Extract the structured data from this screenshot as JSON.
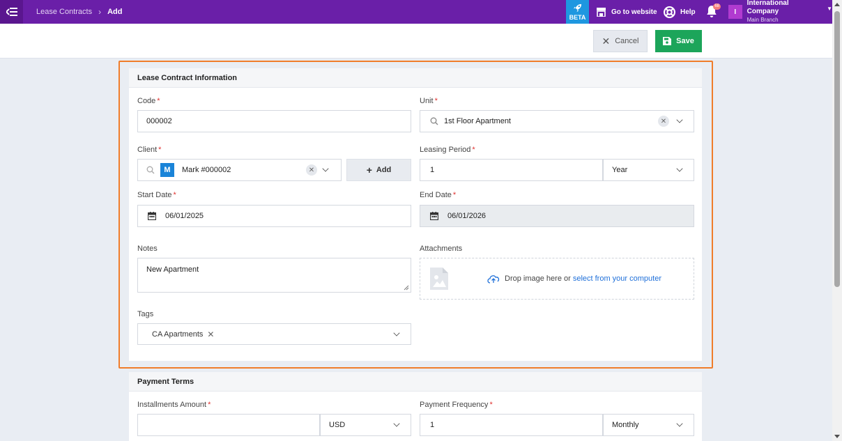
{
  "topbar": {
    "breadcrumb": [
      "Lease Contracts",
      "Add"
    ],
    "beta_label": "BETA",
    "go_to_website": "Go to website",
    "help": "Help",
    "notification_count": "68",
    "company_initial": "I",
    "company_name": "International Company",
    "branch_name": "Main Branch",
    "color_brand": "#6a1fa8",
    "color_beta": "#1e97e0"
  },
  "actions": {
    "cancel_label": "Cancel",
    "save_label": "Save",
    "color_save": "#1ca55a"
  },
  "lease_info": {
    "title": "Lease Contract Information",
    "code": {
      "label": "Code",
      "value": "000002"
    },
    "unit": {
      "label": "Unit",
      "value": "1st Floor Apartment"
    },
    "client": {
      "label": "Client",
      "initial": "M",
      "value": "Mark #000002",
      "add_label": "Add"
    },
    "leasing_period": {
      "label": "Leasing Period",
      "value": "1",
      "unit": "Year"
    },
    "start_date": {
      "label": "Start Date",
      "value": "06/01/2025"
    },
    "end_date": {
      "label": "End Date",
      "value": "06/01/2026"
    },
    "notes": {
      "label": "Notes",
      "value": "New Apartment"
    },
    "attachments": {
      "label": "Attachments",
      "drop_text": "Drop image here or ",
      "select_link": "select from your computer"
    },
    "tags": {
      "label": "Tags",
      "items": [
        "CA Apartments"
      ]
    }
  },
  "payment_terms": {
    "title": "Payment Terms",
    "installments_amount": {
      "label": "Installments Amount",
      "value": "",
      "currency": "USD"
    },
    "payment_frequency": {
      "label": "Payment Frequency",
      "value": "1",
      "unit": "Monthly"
    }
  }
}
